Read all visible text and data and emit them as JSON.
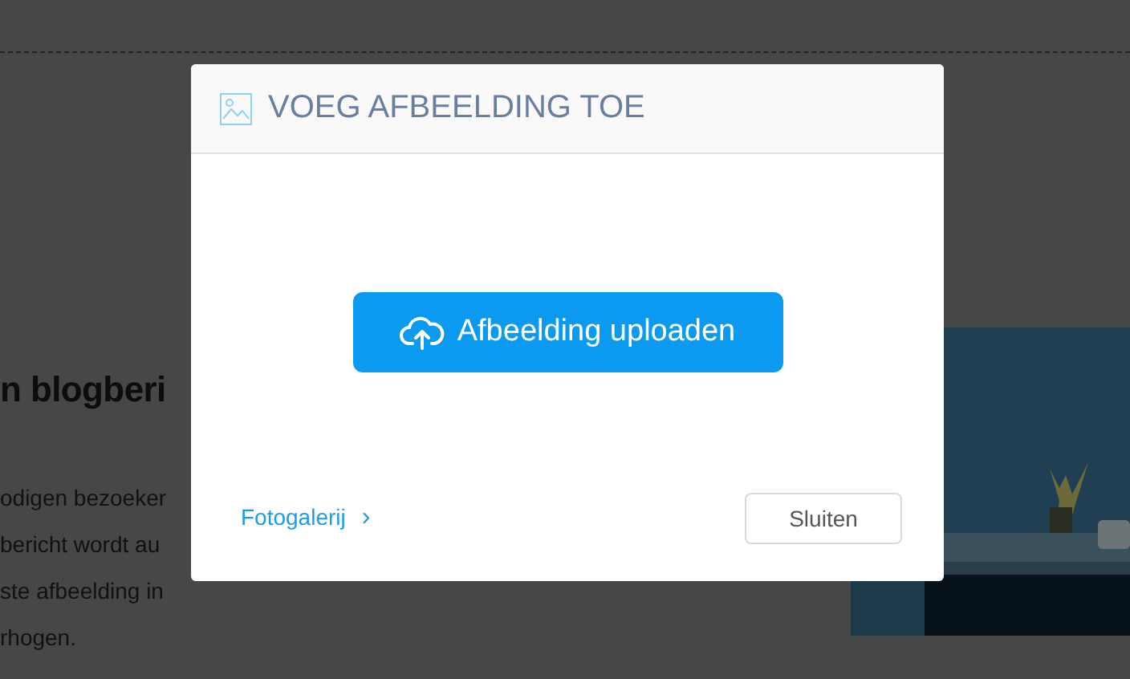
{
  "background_page": {
    "heading": "n blogberi",
    "paragraph_lines": [
      "odigen bezoeker",
      "bericht wordt au",
      "ste afbeelding in",
      "rhogen."
    ]
  },
  "dialog": {
    "title": "VOEG AFBEELDING TOE",
    "upload_button": "Afbeelding uploaden",
    "gallery_link": "Fotogalerij",
    "chevron": "›",
    "close_button": "Sluiten"
  }
}
